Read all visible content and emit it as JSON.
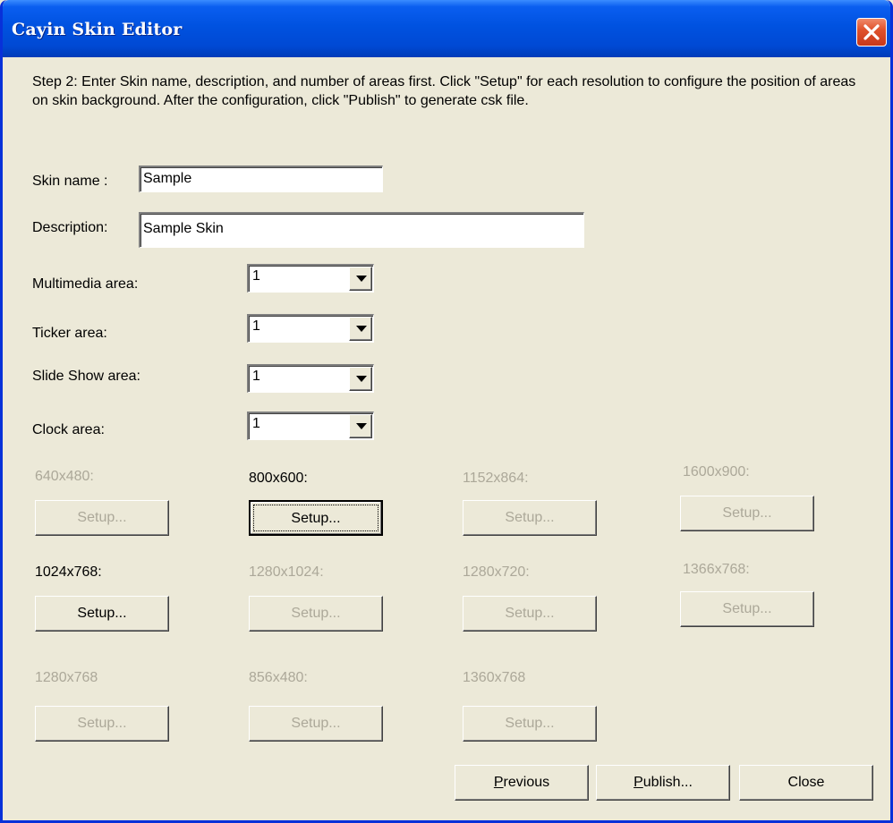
{
  "window": {
    "title": "Cayin Skin Editor"
  },
  "instructions": "Step 2: Enter Skin name, description, and number of areas first. Click \"Setup\" for each resolution to configure the position of areas on skin background. After the configuration, click \"Publish\" to generate csk file.",
  "skin_name": {
    "label": "Skin name :",
    "value": "Sample"
  },
  "description": {
    "label": "Description:",
    "value": "Sample Skin"
  },
  "areas": [
    {
      "label": "Multimedia area:",
      "value": "1"
    },
    {
      "label": "Ticker area:",
      "value": "1"
    },
    {
      "label": "Slide Show area:",
      "value": "1"
    },
    {
      "label": "Clock area:",
      "value": "1"
    }
  ],
  "resolutions": [
    {
      "label": "640x480:",
      "button": "Setup...",
      "enabled": false
    },
    {
      "label": "800x600:",
      "button": "Setup...",
      "enabled": true
    },
    {
      "label": "1152x864:",
      "button": "Setup...",
      "enabled": false
    },
    {
      "label": "1600x900:",
      "button": "Setup...",
      "enabled": false
    },
    {
      "label": "1024x768:",
      "button": "Setup...",
      "enabled": true
    },
    {
      "label": "1280x1024:",
      "button": "Setup...",
      "enabled": false
    },
    {
      "label": "1280x720:",
      "button": "Setup...",
      "enabled": false
    },
    {
      "label": "1366x768:",
      "button": "Setup...",
      "enabled": false
    },
    {
      "label": "1280x768",
      "button": "Setup...",
      "enabled": false
    },
    {
      "label": "856x480:",
      "button": "Setup...",
      "enabled": false
    },
    {
      "label": "1360x768",
      "button": "Setup...",
      "enabled": false
    }
  ],
  "footer": {
    "previous": {
      "mnemonic": "P",
      "rest": "revious"
    },
    "publish": {
      "mnemonic": "P",
      "rest": "ublish..."
    },
    "close": "Close"
  },
  "colors": {
    "titlebar": "#0052e0",
    "face": "#ece9d8",
    "disabled_text": "#aca899",
    "close_button": "#e0532d"
  },
  "icons": {
    "close": "close-x-icon",
    "dropdown": "dropdown-arrow-icon"
  }
}
